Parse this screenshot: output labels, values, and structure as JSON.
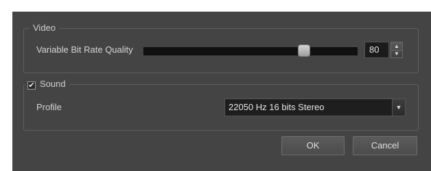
{
  "video": {
    "title": "Video",
    "quality_label": "Variable Bit Rate Quality",
    "quality_value": "80",
    "quality_fraction": 0.77,
    "spin_up_icon": "triangle-up-icon",
    "spin_down_icon": "triangle-down-icon"
  },
  "sound": {
    "title": "Sound",
    "checked": true,
    "check_glyph": "✔",
    "profile_label": "Profile",
    "profile_value": "22050 Hz 16 bits Stereo",
    "dropdown_icon": "triangle-down-icon"
  },
  "buttons": {
    "ok": "OK",
    "cancel": "Cancel"
  },
  "colors": {
    "dialog_bg": "#444444",
    "field_bg": "#1e1e1e",
    "text": "#d6d6d6"
  }
}
